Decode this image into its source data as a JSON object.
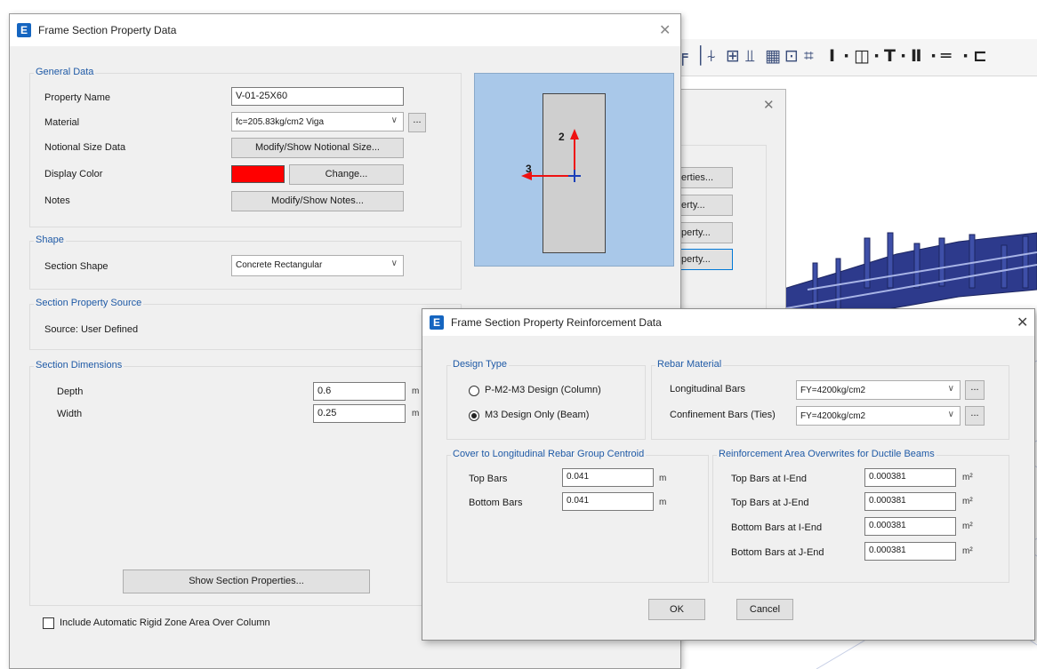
{
  "background_app": {
    "mid_dialog_buttons": [
      "erties...",
      "erty...",
      "perty...",
      "perty..."
    ]
  },
  "main_dialog": {
    "title": "Frame Section Property Data",
    "general_data": {
      "group_label": "General Data",
      "property_name_label": "Property Name",
      "property_name_value": "V-01-25X60",
      "material_label": "Material",
      "material_value": "fc=205.83kg/cm2 Viga",
      "material_more_button": "...",
      "notional_size_label": "Notional Size Data",
      "notional_size_button": "Modify/Show Notional Size...",
      "display_color_label": "Display Color",
      "display_color_value": "#ff0000",
      "change_button": "Change...",
      "notes_label": "Notes",
      "notes_button": "Modify/Show Notes..."
    },
    "shape": {
      "group_label": "Shape",
      "section_shape_label": "Section Shape",
      "section_shape_value": "Concrete Rectangular"
    },
    "source": {
      "group_label": "Section Property Source",
      "source_text": "Source:  User Defined"
    },
    "dimensions": {
      "group_label": "Section Dimensions",
      "depth_label": "Depth",
      "depth_value": "0.6",
      "depth_unit": "m",
      "width_label": "Width",
      "width_value": "0.25",
      "width_unit": "m"
    },
    "preview": {
      "axis_2": "2",
      "axis_3": "3"
    },
    "show_properties_button": "Show Section Properties...",
    "rigid_zone_checkbox_label": "Include Automatic Rigid Zone Area Over Column"
  },
  "reinforcement_dialog": {
    "title": "Frame Section Property Reinforcement Data",
    "design_type": {
      "group_label": "Design Type",
      "option_column": "P-M2-M3 Design  (Column)",
      "option_beam": "M3 Design Only  (Beam)",
      "selected": "beam"
    },
    "rebar_material": {
      "group_label": "Rebar Material",
      "longitudinal_label": "Longitudinal Bars",
      "longitudinal_value": "FY=4200kg/cm2",
      "confinement_label": "Confinement Bars (Ties)",
      "confinement_value": "FY=4200kg/cm2",
      "more_button": "..."
    },
    "cover": {
      "group_label": "Cover to Longitudinal Rebar Group Centroid",
      "top_label": "Top Bars",
      "top_value": "0.041",
      "bottom_label": "Bottom  Bars",
      "bottom_value": "0.041",
      "unit": "m"
    },
    "overwrites": {
      "group_label": "Reinforcement Area Overwrites for Ductile Beams",
      "unit": "m²",
      "rows": [
        {
          "label": "Top Bars at I-End",
          "value": "0.000381"
        },
        {
          "label": "Top Bars at J-End",
          "value": "0.000381"
        },
        {
          "label": "Bottom Bars at I-End",
          "value": "0.000381"
        },
        {
          "label": "Bottom Bars at J-End",
          "value": "0.000381"
        }
      ]
    },
    "ok_button": "OK",
    "cancel_button": "Cancel"
  },
  "colors": {
    "accent": "#0078d7",
    "group_label": "#1f5aa6",
    "model_steel": "#2d3a8c",
    "preview_bg": "#a9c8e9"
  }
}
